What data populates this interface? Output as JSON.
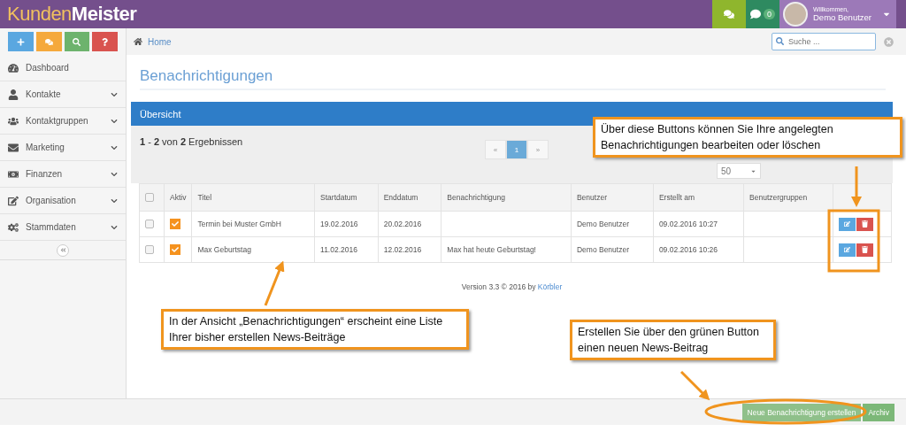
{
  "header": {
    "logo_light": "Kunden",
    "logo_bold": "Meister",
    "notification_count": "0",
    "welcome": "Willkommen,",
    "user_name": "Demo Benutzer"
  },
  "quick_buttons": [
    {
      "kind": "plus"
    },
    {
      "kind": "chat"
    },
    {
      "kind": "search"
    },
    {
      "kind": "help"
    }
  ],
  "sidebar": {
    "items": [
      {
        "label": "Dashboard",
        "expandable": false
      },
      {
        "label": "Kontakte",
        "expandable": true
      },
      {
        "label": "Kontaktgruppen",
        "expandable": true
      },
      {
        "label": "Marketing",
        "expandable": true
      },
      {
        "label": "Finanzen",
        "expandable": true
      },
      {
        "label": "Organisation",
        "expandable": true
      },
      {
        "label": "Stammdaten",
        "expandable": true
      }
    ]
  },
  "breadcrumb": "Home",
  "search": {
    "placeholder": "Suche ..."
  },
  "page_title": "Benachrichtigungen",
  "panel_title": "Übersicht",
  "results": "**1** - **2** von **2** Ergebnissen",
  "pagination": [
    {
      "label": "«",
      "selected": false
    },
    {
      "label": "1",
      "selected": true
    },
    {
      "label": "»",
      "selected": false
    }
  ],
  "per_page": "50",
  "table": {
    "all_checked": false,
    "columns": [
      "Aktiv",
      "Titel",
      "Startdatum",
      "Enddatum",
      "Benachrichtigung",
      "Benutzer",
      "Erstellt am",
      "Benutzergruppen"
    ],
    "rows": [
      {
        "checked": false,
        "active": true,
        "cells": [
          "",
          "Termin bei Muster GmbH",
          "19.02.2016",
          "20.02.2016",
          "",
          "Demo Benutzer",
          "09.02.2016 10:27",
          ""
        ]
      },
      {
        "checked": false,
        "active": true,
        "cells": [
          "",
          "Max Geburtstag",
          "11.02.2016",
          "12.02.2016",
          "Max hat heute Geburtstag!",
          "Demo Benutzer",
          "09.02.2016 10:26",
          ""
        ]
      }
    ]
  },
  "footer": {
    "version": "Version 3.3 © 2016 by",
    "link": "Körbler"
  },
  "actions": [
    "Neue Benachrichtigung erstellen",
    "Archiv"
  ],
  "callouts": [
    "Über diese  Buttons können Sie Ihre angelegten Benachrichtigungen bearbeiten oder löschen",
    "In der Ansicht „Benachrichtigungen“ erscheint eine Liste Ihrer bisher erstellen News-Beiträge",
    "Erstellen Sie über den grünen Button einen neuen News-Beitrag"
  ]
}
